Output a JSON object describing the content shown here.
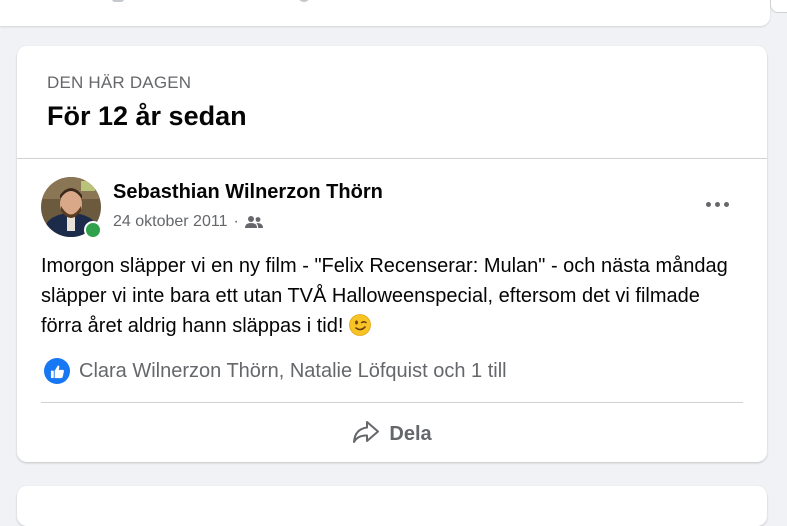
{
  "memory": {
    "eyebrow": "DEN HÄR DAGEN",
    "title": "För 12 år sedan"
  },
  "post": {
    "author": "Sebasthian Wilnerzon Thörn",
    "date": "24 oktober 2011",
    "separator": "·",
    "audience_icon": "friends-icon",
    "text": "Imorgon släpper vi en ny film - \"Felix Recenserar: Mulan\" - och nästa måndag släpper vi inte bara ett utan TVÅ Halloweenspecial, eftersom det vi filmade förra året aldrig hann släppas i tid!",
    "emoji": "winking-face-emoji",
    "online": true
  },
  "reactions": {
    "icon": "like-icon",
    "names": "Clara Wilnerzon Thörn, Natalie Löfquist och 1 till"
  },
  "actions": {
    "share_label": "Dela"
  },
  "colors": {
    "accent": "#1877f2",
    "online": "#31a24c",
    "secondary_text": "#65676b",
    "background": "#f0f2f5"
  }
}
